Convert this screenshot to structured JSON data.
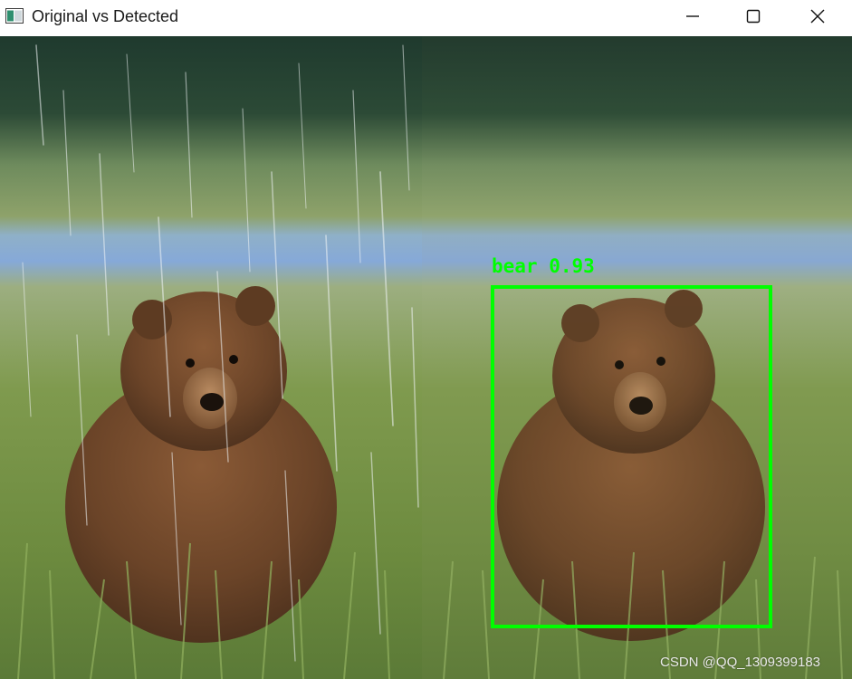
{
  "window": {
    "title": "Original vs Detected",
    "app_icon": "image-window-icon",
    "controls": [
      "minimize-icon",
      "maximize-icon",
      "close-icon"
    ]
  },
  "panels": [
    {
      "name": "original",
      "description_label": ""
    },
    {
      "name": "detected",
      "description_label": ""
    }
  ],
  "detection": {
    "label": "bear 0.93",
    "class": "bear",
    "confidence": 0.93,
    "box_color": "#00ff00"
  },
  "watermark": "CSDN @QQ_1309399183"
}
